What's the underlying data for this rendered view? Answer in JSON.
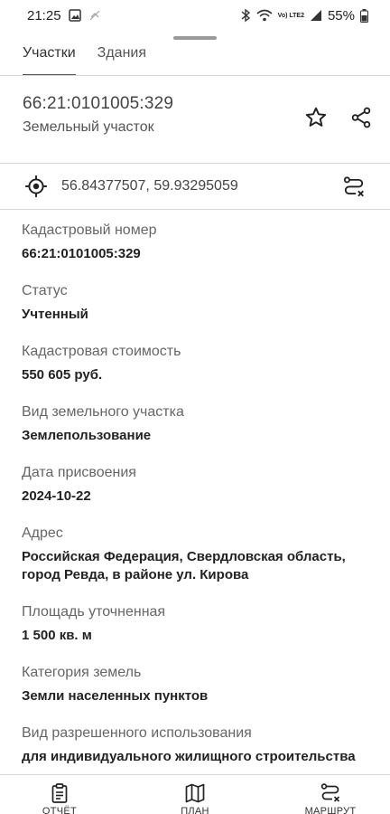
{
  "status_bar": {
    "time": "21:25",
    "network": "Vo) LTE2",
    "battery": "55%"
  },
  "tabs": [
    {
      "label": "Участки",
      "active": true
    },
    {
      "label": "Здания",
      "active": false
    }
  ],
  "header": {
    "parcel_id": "66:21:0101005:329",
    "parcel_type": "Земельный участок"
  },
  "coords": {
    "value": "56.84377507, 59.93295059"
  },
  "fields": [
    {
      "label": "Кадастровый номер",
      "value": "66:21:0101005:329"
    },
    {
      "label": "Статус",
      "value": "Учтенный"
    },
    {
      "label": "Кадастровая стоимость",
      "value": "550 605 руб."
    },
    {
      "label": "Вид земельного участка",
      "value": "Землепользование"
    },
    {
      "label": "Дата присвоения",
      "value": "2024-10-22"
    },
    {
      "label": "Адрес",
      "value": "Российская Федерация, Свердловская область, город Ревда, в районе ул. Кирова"
    },
    {
      "label": "Площадь уточненная",
      "value": "1 500 кв. м"
    },
    {
      "label": "Категория земель",
      "value": "Земли населенных пунктов"
    },
    {
      "label": "Вид разрешенного использования",
      "value": "для индивидуального жилищного строительства"
    }
  ],
  "bottom_nav": [
    {
      "label": "ОТЧЁТ",
      "icon": "report-icon"
    },
    {
      "label": "ПЛАН",
      "icon": "map-icon"
    },
    {
      "label": "МАРШРУТ",
      "icon": "route-icon"
    }
  ]
}
